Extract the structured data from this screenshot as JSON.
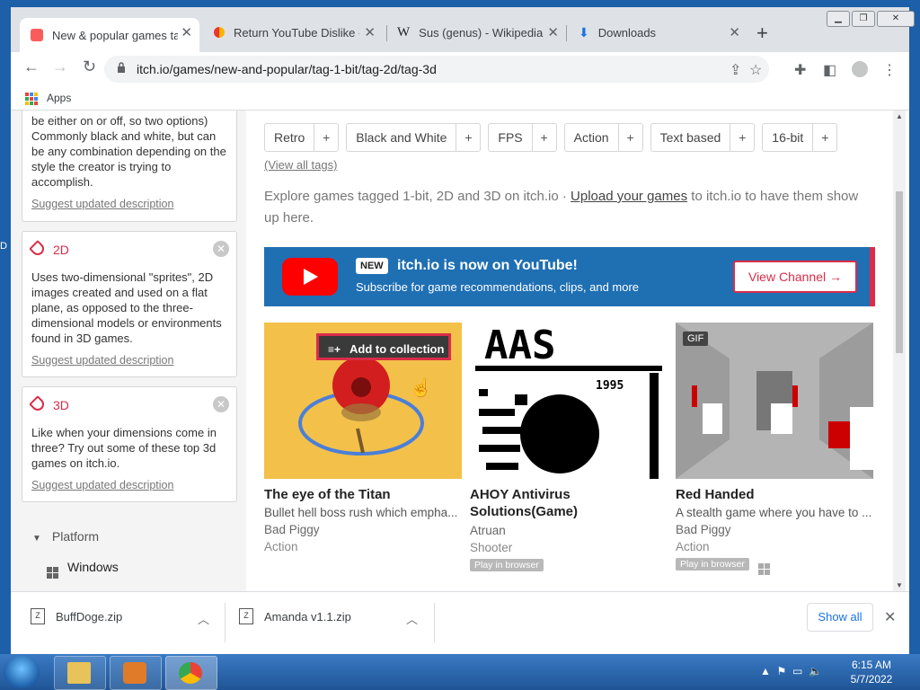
{
  "browser": {
    "tabs": [
      {
        "title": "New & popular games tag"
      },
      {
        "title": "Return YouTube Dislike - C"
      },
      {
        "title": "Sus (genus) - Wikipedia"
      },
      {
        "title": "Downloads"
      }
    ],
    "url": "itch.io/games/new-and-popular/tag-1-bit/tag-2d/tag-3d",
    "bookmarks_apps": "Apps"
  },
  "sidebar": {
    "partial_desc": "be either on or off, so two options) Commonly black and white, but can be any combination depending on the style the creator is trying to accomplish.",
    "suggest_label": "Suggest updated description",
    "tags": [
      {
        "name": "2D",
        "desc": "Uses two-dimensional \"sprites\", 2D images created and used on a flat plane, as opposed to the three-dimensional models or environments found in 3D games."
      },
      {
        "name": "3D",
        "desc": "Like when your dimensions come in three? Try out some of these top 3d games on itch.io."
      }
    ],
    "platform_label": "Platform",
    "windows_label": "Windows"
  },
  "main": {
    "tag_buttons": [
      "Retro",
      "Black and White",
      "FPS",
      "Action",
      "Text based",
      "16-bit"
    ],
    "view_all": "(View all tags)",
    "explore_pre": "Explore games tagged 1-bit, 2D and 3D on itch.io · ",
    "explore_link": "Upload your games",
    "explore_post": " to itch.io to have them show up here.",
    "banner": {
      "badge": "NEW",
      "headline": "itch.io is now on YouTube!",
      "sub": "Subscribe for game recommendations, clips, and more",
      "button": "View Channel →"
    },
    "add_to_collection": "Add to collection",
    "games": [
      {
        "title": "The eye of the Titan",
        "short": "Bullet hell boss rush which empha...",
        "author": "Bad Piggy",
        "genre": "Action",
        "badge": ""
      },
      {
        "title": "AHOY Antivirus Solutions(Game)",
        "short": "",
        "author": "Atruan",
        "genre": "Shooter",
        "badge": "Play in browser"
      },
      {
        "title": "Red Handed",
        "short": "A stealth game where you have to ...",
        "author": "Bad Piggy",
        "genre": "Action",
        "badge": "Play in browser",
        "gif": "GIF"
      }
    ],
    "aas_text": "AAS",
    "aas_year": "1995"
  },
  "downloads": {
    "items": [
      {
        "name": "BuffDoge.zip"
      },
      {
        "name": "Amanda v1.1.zip"
      }
    ],
    "show_all": "Show all"
  },
  "taskbar": {
    "time": "6:15 AM",
    "date": "5/7/2022"
  },
  "colors": {
    "accent": "#da2c49",
    "banner": "#1f6fb3"
  }
}
